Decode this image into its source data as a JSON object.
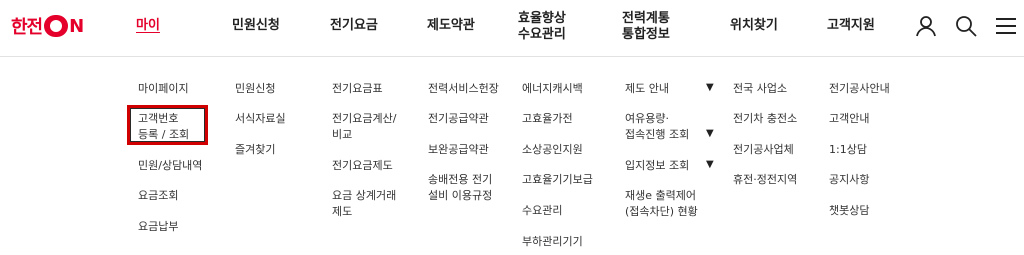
{
  "logo": {
    "text_left": "한전",
    "text_right": "N"
  },
  "gnb": {
    "items": [
      {
        "label": "마이"
      },
      {
        "label": "민원신청"
      },
      {
        "label": "전기요금"
      },
      {
        "label": "제도약관"
      },
      {
        "label_line1": "효율향상",
        "label_line2": "수요관리"
      },
      {
        "label_line1": "전력계통",
        "label_line2": "통합정보"
      },
      {
        "label": "위치찾기"
      },
      {
        "label": "고객지원"
      }
    ]
  },
  "utility": {
    "user_icon": "user-icon",
    "search_icon": "search-icon",
    "menu_icon": "hamburger-menu-icon"
  },
  "submenu": {
    "mypage": [
      "마이페이지",
      "고객번호\n등록 / 조회",
      "민원/상담내역",
      "요금조회",
      "요금납부"
    ],
    "civil": [
      "민원신청",
      "서식자료실",
      "즐겨찾기"
    ],
    "charge": [
      "전기요금표",
      "전기요금계산/\n비교",
      "전기요금제도",
      "요금 상계거래\n제도"
    ],
    "terms": [
      "전력서비스헌장",
      "전기공급약관",
      "보완공급약관",
      "송배전용 전기\n설비 이용규정"
    ],
    "efficiency": [
      "에너지캐시백",
      "고효율가전",
      "소상공인지원",
      "고효율기기보급",
      "수요관리",
      "부하관리기기"
    ],
    "grid": [
      "제도 안내",
      "여유용량·\n접속진행 조회",
      "입지정보 조회",
      "재생e 출력제어\n(접속차단) 현황"
    ],
    "location": [
      "전국 사업소",
      "전기차 충전소",
      "전기공사업체",
      "휴전·정전지역"
    ],
    "support": [
      "전기공사안내",
      "고객안내",
      "1:1상담",
      "공지사항",
      "챗봇상담"
    ]
  },
  "colors": {
    "brand": "#e4002b",
    "highlight": "#d10000"
  }
}
